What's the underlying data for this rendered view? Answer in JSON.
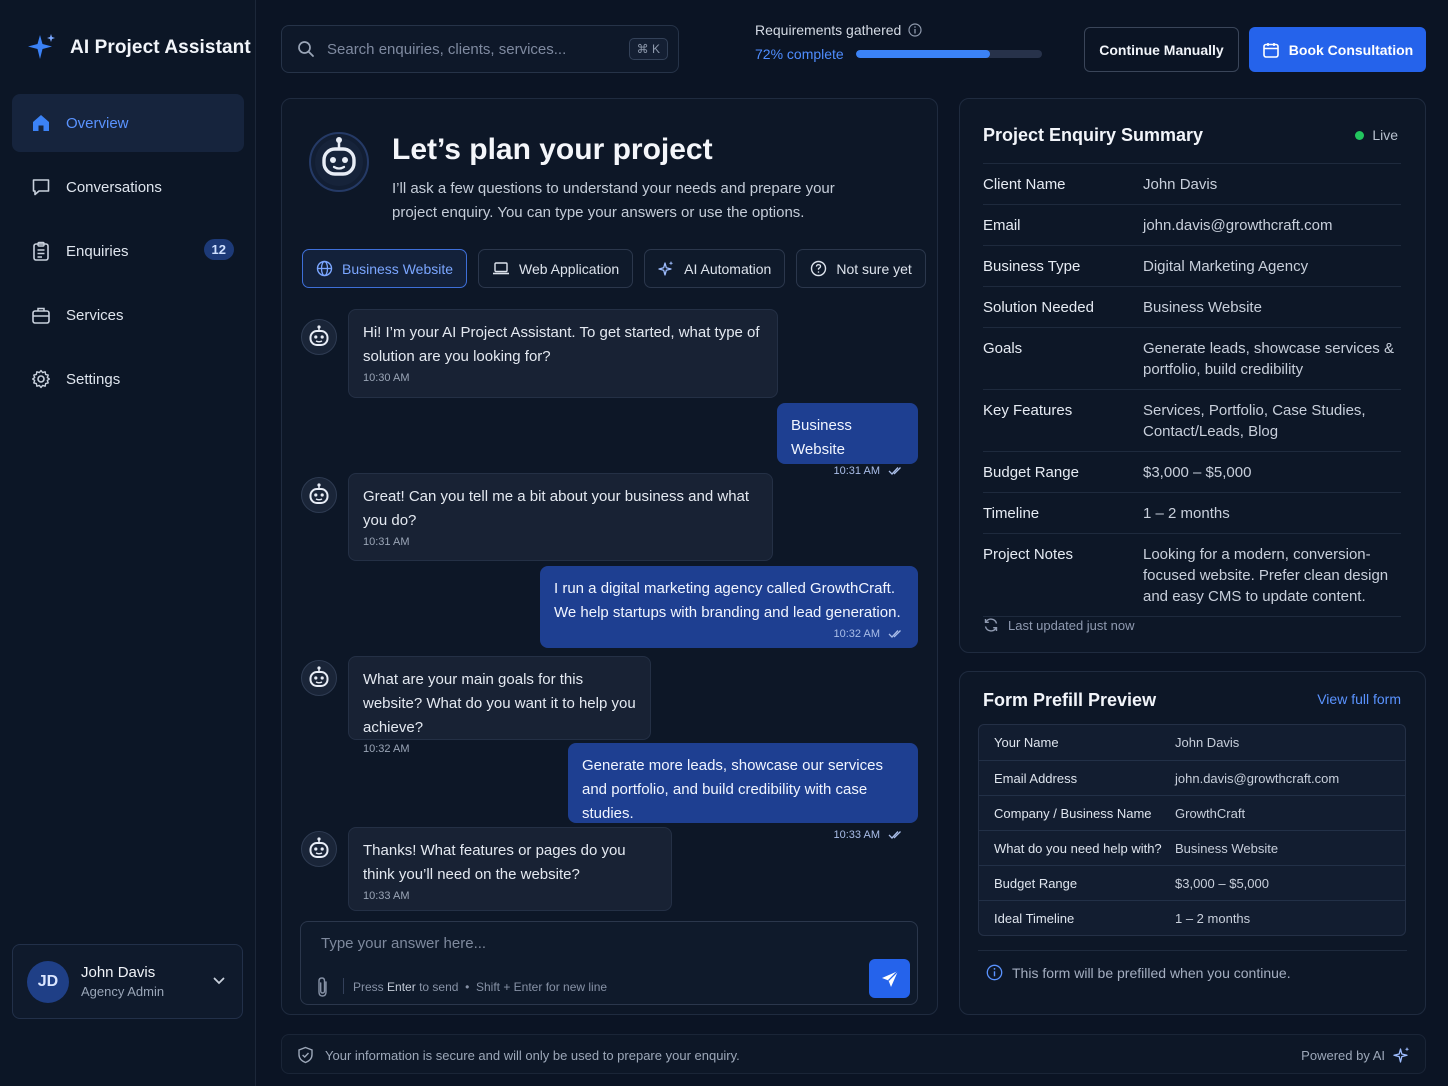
{
  "app": {
    "title": "AI Project Assistant"
  },
  "sidebar": {
    "items": [
      {
        "label": "Overview",
        "active": true
      },
      {
        "label": "Conversations"
      },
      {
        "label": "Enquiries",
        "badge": "12"
      },
      {
        "label": "Services"
      },
      {
        "label": "Settings"
      }
    ],
    "user": {
      "initials": "JD",
      "name": "John Davis",
      "role": "Agency Admin"
    }
  },
  "search": {
    "placeholder": "Search enquiries, clients, services...",
    "shortcut": "⌘ K"
  },
  "progress": {
    "label": "Requirements gathered",
    "text": "72% complete",
    "value": 72
  },
  "header": {
    "continue_label": "Continue Manually",
    "book_label": "Book Consultation"
  },
  "chat": {
    "title": "Let’s plan your project",
    "subtitle": "I’ll ask a few questions to understand your needs and prepare your project enquiry. You can type your answers or use the options.",
    "options": [
      {
        "label": "Business Website",
        "active": true
      },
      {
        "label": "Web Application"
      },
      {
        "label": "AI Automation"
      },
      {
        "label": "Not sure yet"
      }
    ],
    "messages": [
      {
        "from": "bot",
        "text": "Hi! I’m your AI Project Assistant. To get started, what type of solution are you looking for?",
        "time": "10:30 AM"
      },
      {
        "from": "user",
        "text": "Business Website",
        "time": "10:31 AM"
      },
      {
        "from": "bot",
        "text": "Great! Can you tell me a bit about your business and what you do?",
        "time": "10:31 AM"
      },
      {
        "from": "user",
        "text": "I run a digital marketing agency called GrowthCraft. We help startups with branding and lead generation.",
        "time": "10:32 AM"
      },
      {
        "from": "bot",
        "text": "What are your main goals for this website? What do you want it to help you achieve?",
        "time": "10:32 AM"
      },
      {
        "from": "user",
        "text": "Generate more leads, showcase our services and portfolio, and build credibility with case studies.",
        "time": "10:33 AM"
      },
      {
        "from": "bot",
        "text": "Thanks! What features or pages do you think you’ll need on the website?",
        "time": "10:33 AM"
      }
    ],
    "composer": {
      "placeholder": "Type your answer here...",
      "hint_press": "Press",
      "hint_enter": "Enter",
      "hint_send": "to send",
      "hint_dot": "•",
      "hint_shift": "Shift + Enter for new line"
    }
  },
  "summary": {
    "title": "Project Enquiry Summary",
    "status": "Live",
    "rows": [
      {
        "key": "Client Name",
        "value": "John Davis"
      },
      {
        "key": "Email",
        "value": "john.davis@growthcraft.com"
      },
      {
        "key": "Business Type",
        "value": "Digital Marketing Agency"
      },
      {
        "key": "Solution Needed",
        "value": "Business Website"
      },
      {
        "key": "Goals",
        "value": "Generate leads, showcase services & portfolio, build credibility"
      },
      {
        "key": "Key Features",
        "value": "Services, Portfolio, Case Studies, Contact/Leads, Blog"
      },
      {
        "key": "Budget Range",
        "value": "$3,000 – $5,000"
      },
      {
        "key": "Timeline",
        "value": "1 – 2 months"
      },
      {
        "key": "Project Notes",
        "value": "Looking for a modern, conversion-focused website. Prefer clean design and easy CMS to update content."
      }
    ],
    "last_updated": "Last updated just now"
  },
  "form": {
    "title": "Form Prefill Preview",
    "link": "View full form",
    "rows": [
      {
        "key": "Your Name",
        "value": "John Davis"
      },
      {
        "key": "Email Address",
        "value": "john.davis@growthcraft.com"
      },
      {
        "key": "Company / Business Name",
        "value": "GrowthCraft"
      },
      {
        "key": "What do you need help with?",
        "value": "Business Website"
      },
      {
        "key": "Budget Range",
        "value": "$3,000 – $5,000"
      },
      {
        "key": "Ideal Timeline",
        "value": "1 – 2 months"
      }
    ],
    "note": "This form will be prefilled when you continue."
  },
  "footer": {
    "secure": "Your information is secure and will only be used to prepare your enquiry.",
    "powered": "Powered by AI"
  },
  "colors": {
    "accent": "#2563eb",
    "live": "#22c55e",
    "user_bubble": "#1e3f91"
  }
}
